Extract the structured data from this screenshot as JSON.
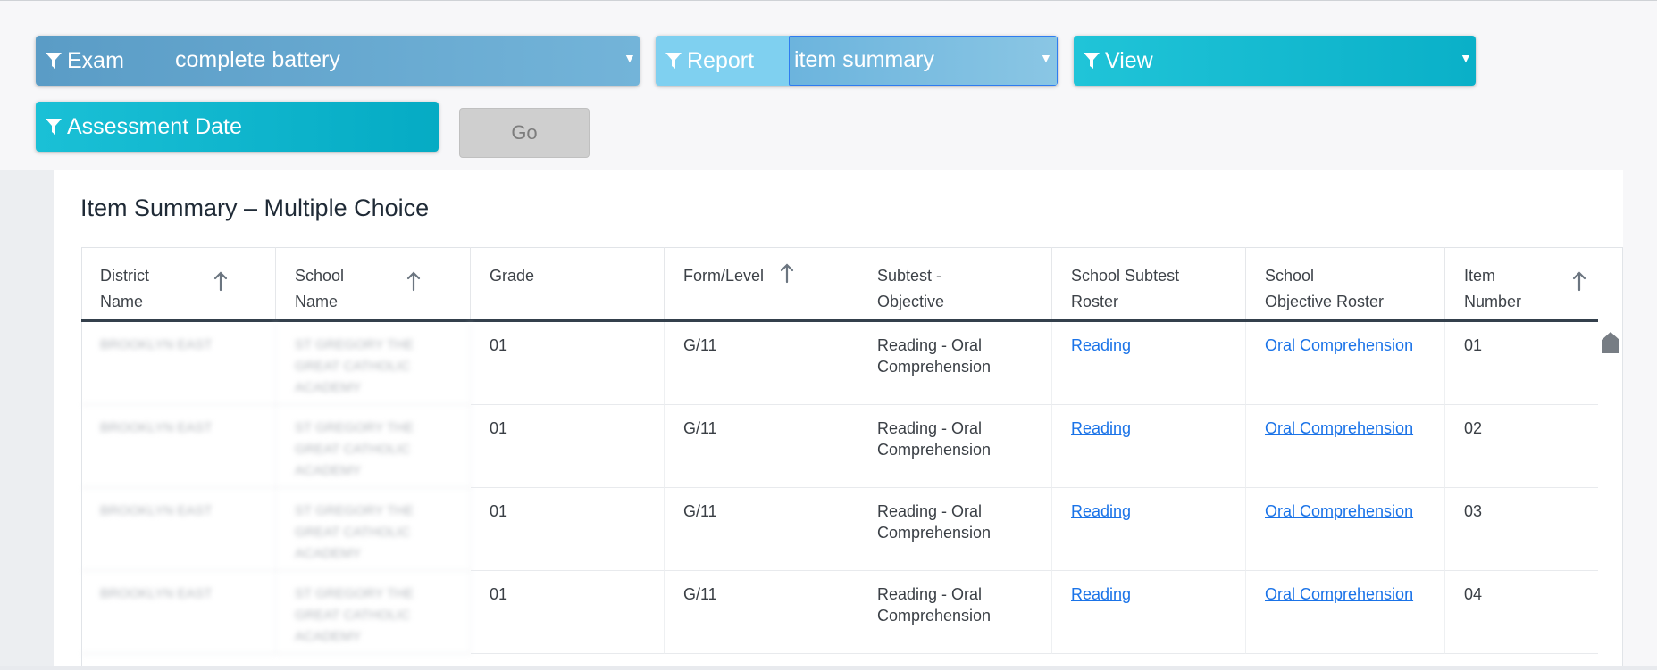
{
  "filters": {
    "exam": {
      "label": "Exam",
      "value": "complete battery"
    },
    "report": {
      "label": "Report",
      "value": "item summary"
    },
    "view": {
      "label": "View",
      "value": ""
    },
    "assessment_date": {
      "label": "Assessment Date"
    },
    "go_label": "Go"
  },
  "section_title": "Item Summary – Multiple Choice",
  "table": {
    "columns": [
      {
        "line1": "District",
        "line2": "Name",
        "sortable": true
      },
      {
        "line1": "School",
        "line2": "Name",
        "sortable": true
      },
      {
        "line1": "Grade",
        "line2": "",
        "sortable": false
      },
      {
        "line1": "Form/Level",
        "line2": "",
        "sortable": true
      },
      {
        "line1": "Subtest -",
        "line2": "Objective",
        "sortable": false
      },
      {
        "line1": "School Subtest",
        "line2": "Roster",
        "sortable": false
      },
      {
        "line1": "School",
        "line2": "Objective Roster",
        "sortable": false
      },
      {
        "line1": "Item",
        "line2": "Number",
        "sortable": true
      }
    ],
    "rows": [
      {
        "district": "BROOKLYN EAST",
        "school": "ST GREGORY THE GREAT CATHOLIC ACADEMY",
        "grade": "01",
        "form_level": "G/11",
        "subtest_line1": "Reading - Oral",
        "subtest_line2": "Comprehension",
        "subtest_roster": "Reading",
        "objective_roster": "Oral Comprehension",
        "item_number": "01"
      },
      {
        "district": "BROOKLYN EAST",
        "school": "ST GREGORY THE GREAT CATHOLIC ACADEMY",
        "grade": "01",
        "form_level": "G/11",
        "subtest_line1": "Reading - Oral",
        "subtest_line2": "Comprehension",
        "subtest_roster": "Reading",
        "objective_roster": "Oral Comprehension",
        "item_number": "02"
      },
      {
        "district": "BROOKLYN EAST",
        "school": "ST GREGORY THE GREAT CATHOLIC ACADEMY",
        "grade": "01",
        "form_level": "G/11",
        "subtest_line1": "Reading - Oral",
        "subtest_line2": "Comprehension",
        "subtest_roster": "Reading",
        "objective_roster": "Oral Comprehension",
        "item_number": "03"
      },
      {
        "district": "BROOKLYN EAST",
        "school": "ST GREGORY THE GREAT CATHOLIC ACADEMY",
        "grade": "01",
        "form_level": "G/11",
        "subtest_line1": "Reading - Oral",
        "subtest_line2": "Comprehension",
        "subtest_roster": "Reading",
        "objective_roster": "Oral Comprehension",
        "item_number": "04"
      }
    ]
  },
  "icons": {
    "filter": "filter-funnel-icon",
    "dropdown": "caret-down-icon",
    "sort": "sort-arrow-up-icon",
    "scroll": "scroll-thumb-icon"
  },
  "colors": {
    "link": "#1a73e8",
    "header_rule": "#34404c",
    "exam_filter": "#5a9cc6",
    "report_filter": "#7fd0f0",
    "view_filter": "#0ab0c8",
    "go_disabled": "#cfcfcf"
  }
}
